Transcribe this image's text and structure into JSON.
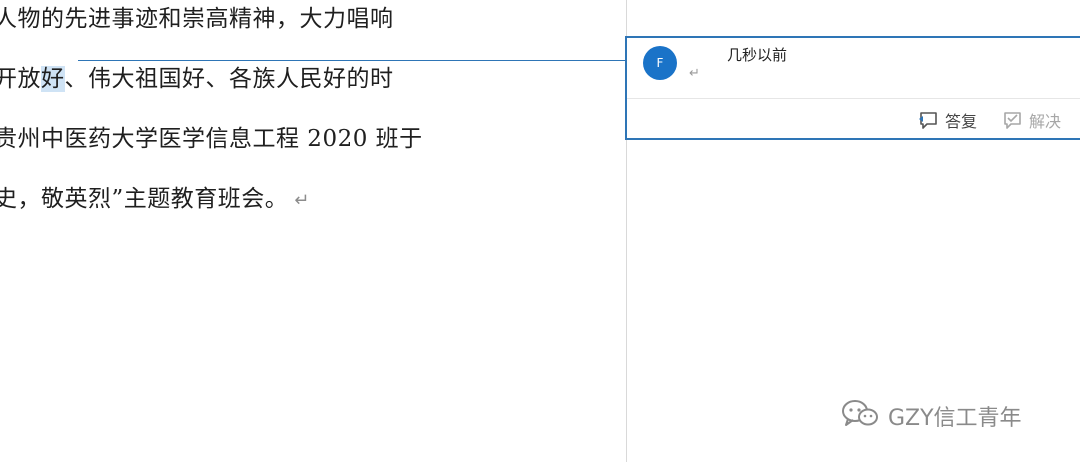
{
  "document": {
    "lines": [
      "人物的先进事迹和崇高精神，大力唱响",
      "开放",
      "、伟大祖国好、各族人民好的时",
      "贵州中医药大学医学信息工程 2020 班于",
      "史，敬英烈”主题教育班会。"
    ],
    "selected_text": "好",
    "paragraph_mark": "↵"
  },
  "comment": {
    "avatar_initial": "F",
    "time": "几秒以前",
    "body_mark": "↵",
    "reply_label": "答复",
    "resolve_label": "解决"
  },
  "watermark": {
    "text": "GZY信工青年"
  },
  "colors": {
    "accent": "#2e75b6",
    "avatar": "#1a73c8",
    "highlight": "#cfe3f5"
  },
  "icons": {
    "reply": "reply-comment-icon",
    "resolve": "resolve-comment-icon",
    "watermark": "wechat-logo-icon"
  }
}
